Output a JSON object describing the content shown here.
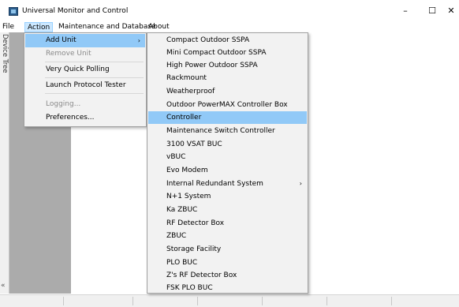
{
  "window": {
    "title": "Universal Monitor and Control",
    "minimize": "–",
    "maximize": "☐",
    "close": "✕"
  },
  "menubar": {
    "file": "File",
    "action": "Action",
    "maintenance": "Maintenance and Database",
    "about": "About"
  },
  "sidebar": {
    "label": "Device Tree",
    "collapse": "«"
  },
  "action_menu": {
    "items": [
      {
        "label": "Add Unit",
        "state": "highlighted",
        "arrow": "›"
      },
      {
        "label": "Remove Unit",
        "state": "disabled"
      },
      {
        "label": "Very Quick Polling",
        "state": "normal"
      },
      {
        "label": "Launch Protocol Tester",
        "state": "normal"
      },
      {
        "label": "Logging...",
        "state": "disabled"
      },
      {
        "label": "Preferences...",
        "state": "normal"
      }
    ]
  },
  "add_unit_submenu": {
    "items": [
      {
        "label": "Compact Outdoor SSPA"
      },
      {
        "label": "Mini Compact Outdoor SSPA"
      },
      {
        "label": "High Power Outdoor SSPA"
      },
      {
        "label": "Rackmount"
      },
      {
        "label": "Weatherproof"
      },
      {
        "label": "Outdoor PowerMAX Controller Box"
      },
      {
        "label": "Controller",
        "highlighted": true
      },
      {
        "label": "Maintenance Switch Controller"
      },
      {
        "label": "3100 VSAT BUC"
      },
      {
        "label": "vBUC"
      },
      {
        "label": "Evo Modem"
      },
      {
        "label": "Internal Redundant System",
        "arrow": "›"
      },
      {
        "label": "N+1 System"
      },
      {
        "label": "Ka ZBUC"
      },
      {
        "label": "RF Detector Box"
      },
      {
        "label": "ZBUC"
      },
      {
        "label": "Storage Facility"
      },
      {
        "label": "PLO BUC"
      },
      {
        "label": "Z's RF Detector Box"
      },
      {
        "label": "FSK PLO BUC"
      }
    ]
  },
  "colors": {
    "highlight": "#91c9f7",
    "menubar_active": "#cce8ff",
    "workspace_gray": "#ababab",
    "menu_bg": "#f2f2f2"
  }
}
